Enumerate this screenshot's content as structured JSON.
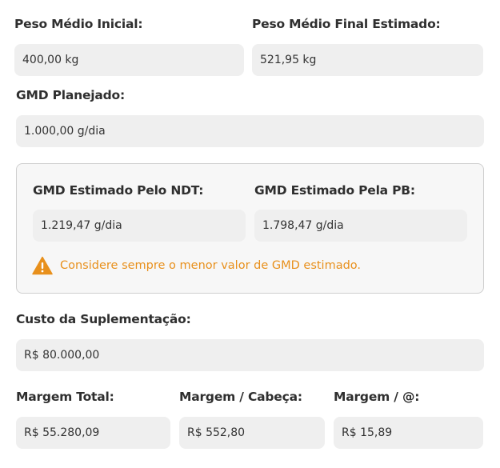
{
  "peso_inicial": {
    "label": "Peso Médio Inicial:",
    "value": "400,00 kg"
  },
  "peso_final": {
    "label": "Peso Médio Final Estimado:",
    "value": "521,95 kg"
  },
  "gmd_planejado": {
    "label": "GMD Planejado:",
    "value": "1.000,00 g/dia"
  },
  "gmd_estimado": {
    "ndt": {
      "label": "GMD Estimado Pelo NDT:",
      "value": "1.219,47 g/dia"
    },
    "pb": {
      "label": "GMD Estimado Pela PB:",
      "value": "1.798,47 g/dia"
    },
    "warning": {
      "icon": "warning-triangle-icon",
      "color": "#e8901c",
      "text": "Considere sempre o menor valor de GMD estimado."
    }
  },
  "custo_suplementacao": {
    "label": "Custo da Suplementação:",
    "value": "R$ 80.000,00"
  },
  "margens": {
    "total": {
      "label": "Margem Total:",
      "value": "R$ 55.280,09"
    },
    "cabeca": {
      "label": "Margem / Cabeça:",
      "value": "R$ 552,80"
    },
    "arroba": {
      "label": "Margem / @:",
      "value": "R$ 15,89"
    }
  }
}
